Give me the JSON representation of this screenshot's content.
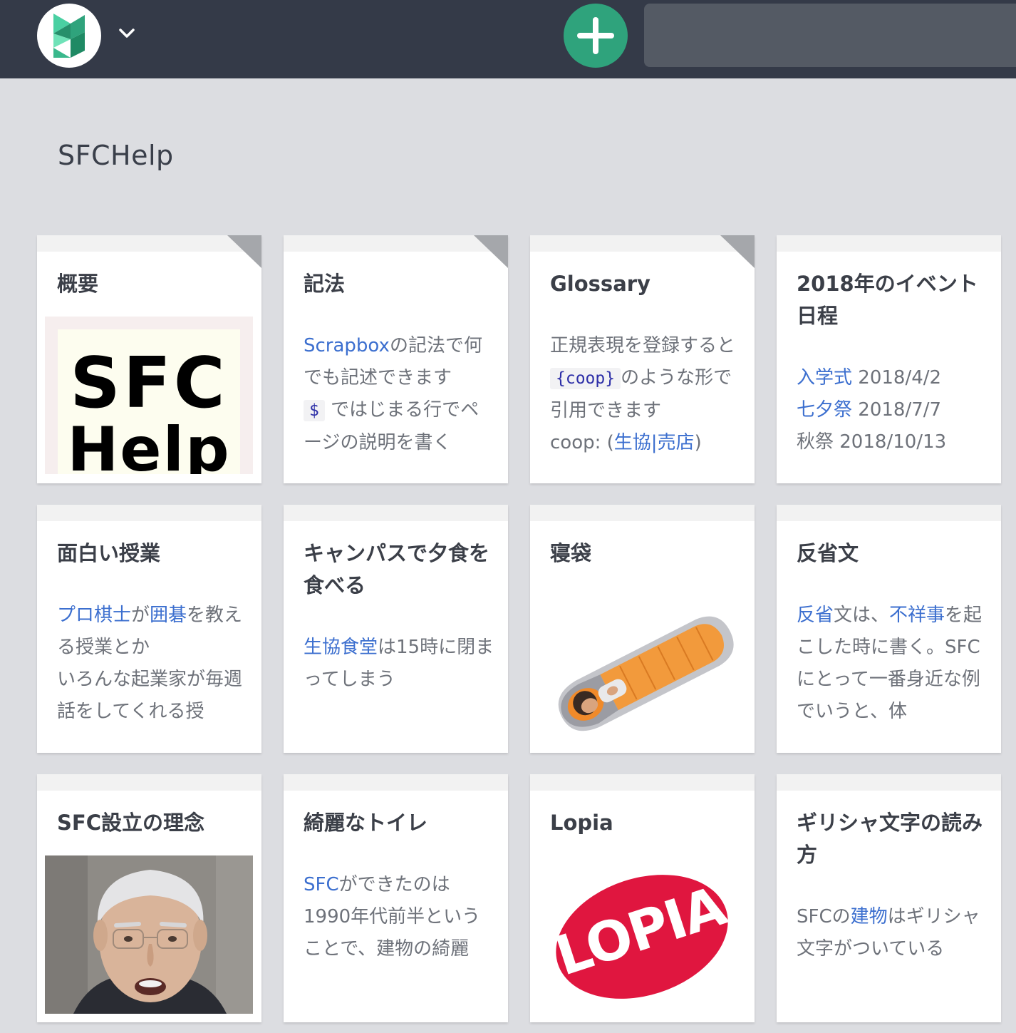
{
  "header": {
    "search_placeholder": ""
  },
  "project": {
    "title": "SFCHelp"
  },
  "cards": [
    {
      "title": "概要",
      "thumb_text_1": "SFC",
      "thumb_text_2": "Help"
    },
    {
      "title": "記法",
      "body": {
        "link1": "Scrapbox",
        "text1": "の記法で何でも記述できます",
        "code": "$",
        "text2": "ではじまる行でページの説明を書く"
      }
    },
    {
      "title": "Glossary",
      "body": {
        "text1": "正規表現を登録すると",
        "code": "{coop}",
        "text2": "のような形で引用できます",
        "text3": "coop: (",
        "link1": "生協",
        "sep": "|",
        "link2": "売店",
        "text4": ")"
      }
    },
    {
      "title": "2018年のイベント日程",
      "body": {
        "link1": "入学式",
        "date1": " 2018/4/2",
        "link2": "七夕祭",
        "date2": " 2018/7/7",
        "text3": "秋祭 2018/10/13"
      }
    },
    {
      "title": "面白い授業",
      "body": {
        "link1": "プロ棋士",
        "text1": "が",
        "link2": "囲碁",
        "text2": "を教える授業とか",
        "text3": "いろんな起業家が毎週話をしてくれる授"
      }
    },
    {
      "title": "キャンパスで夕食を食べる",
      "body": {
        "link1": "生協食堂",
        "text1": "は15時に閉まってしまう"
      }
    },
    {
      "title": "寝袋"
    },
    {
      "title": "反省文",
      "body": {
        "link1": "反省",
        "text1": "文は、",
        "link2": "不祥事",
        "text2": "を起こした時に書く。SFCにとって一番身近な例でいうと、体"
      }
    },
    {
      "title": "SFC設立の理念"
    },
    {
      "title": "綺麗なトイレ",
      "body": {
        "link1": "SFC",
        "text1": "ができたのは1990年代前半ということで、建物の綺麗"
      }
    },
    {
      "title": "Lopia",
      "logo_text": "LOPIA"
    },
    {
      "title": "ギリシャ文字の読み方",
      "body": {
        "text1": "SFCの",
        "link1": "建物",
        "text2": "はギリシャ文字がついている"
      }
    }
  ],
  "colors": {
    "topbar": "#343a48",
    "accent_green": "#2fa37c",
    "link": "#3c6fcf",
    "background": "#dcdde1",
    "lopia_red": "#e0163f"
  }
}
